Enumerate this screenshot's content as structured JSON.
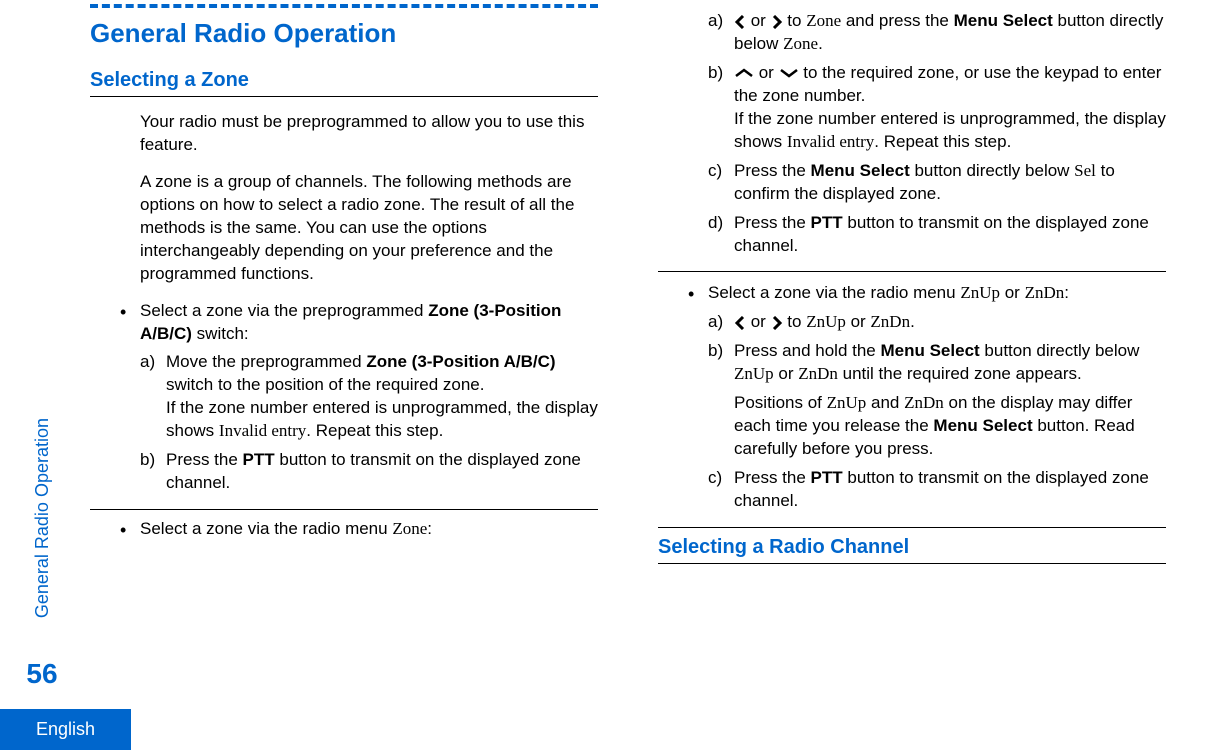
{
  "sidebar": {
    "vertical_label": "General Radio Operation",
    "page_number": "56",
    "language": "English"
  },
  "col1": {
    "h1": "General Radio Operation",
    "h2": "Selecting a Zone",
    "p1": "Your radio must be preprogrammed to allow you to use this feature.",
    "p2": "A zone is a group of channels. The following methods are options on how to select a radio zone. The result of all the methods is the same. You can use the options interchangeably depending on your preference and the programmed functions.",
    "bullet1": {
      "intro_pre": "Select a zone via the preprogrammed ",
      "intro_bold": "Zone (3-Position A/B/C)",
      "intro_post": " switch:",
      "a_marker": "a)",
      "a_pre": "Move the preprogrammed ",
      "a_bold": "Zone (3-Position A/B/C)",
      "a_post": " switch to the position of the required zone.",
      "a_line2_pre": "If the zone number entered is unprogrammed, the display shows ",
      "a_line2_serif": "Invalid entry",
      "a_line2_post": ". Repeat this step.",
      "b_marker": "b)",
      "b_pre": "Press the ",
      "b_bold": "PTT",
      "b_post": " button to transmit on the displayed zone channel."
    },
    "bullet2": {
      "intro_pre": "Select a zone via the radio menu ",
      "intro_serif": "Zone",
      "intro_post": ":"
    }
  },
  "col2": {
    "cont": {
      "a_marker": "a)",
      "a_or": " or ",
      "a_to": " to ",
      "a_serif": "Zone",
      "a_post_pre": " and press the ",
      "a_bold": "Menu Select",
      "a_post_mid": " button directly below ",
      "a_serif2": "Zone",
      "a_post_end": ".",
      "b_marker": "b)",
      "b_or": " or ",
      "b_post": " to the required zone, or use the keypad to enter the zone number.",
      "b_line2_pre": "If the zone number entered is unprogrammed, the display shows ",
      "b_line2_serif": "Invalid entry",
      "b_line2_post": ". Repeat this step.",
      "c_marker": "c)",
      "c_pre": "Press the ",
      "c_bold": "Menu Select",
      "c_mid": " button directly below ",
      "c_serif": "Sel",
      "c_post": " to confirm the displayed zone.",
      "d_marker": "d)",
      "d_pre": "Press the ",
      "d_bold": "PTT",
      "d_post": " button to transmit on the displayed zone channel."
    },
    "bullet3": {
      "intro_pre": "Select a zone via the radio menu ",
      "intro_serif1": "ZnUp",
      "intro_or": " or ",
      "intro_serif2": "ZnDn",
      "intro_post": ":",
      "a_marker": "a)",
      "a_or": " or ",
      "a_to": " to ",
      "a_serif1": "ZnUp",
      "a_or2": " or ",
      "a_serif2": "ZnDn",
      "a_post": ".",
      "b_marker": "b)",
      "b_pre": "Press and hold the ",
      "b_bold": "Menu Select",
      "b_mid": " button directly below ",
      "b_serif1": "ZnUp",
      "b_or": " or ",
      "b_serif2": "ZnDn",
      "b_post": " until the required zone appears.",
      "b_para_pre": "Positions of ",
      "b_para_serif1": "ZnUp",
      "b_para_and": " and ",
      "b_para_serif2": "ZnDn",
      "b_para_mid": " on the display may differ each time you release the ",
      "b_para_bold": "Menu Select",
      "b_para_post": " button. Read carefully before you press.",
      "c_marker": "c)",
      "c_pre": "Press the ",
      "c_bold": "PTT",
      "c_post": " button to transmit on the displayed zone channel."
    },
    "h2": "Selecting a Radio Channel"
  }
}
